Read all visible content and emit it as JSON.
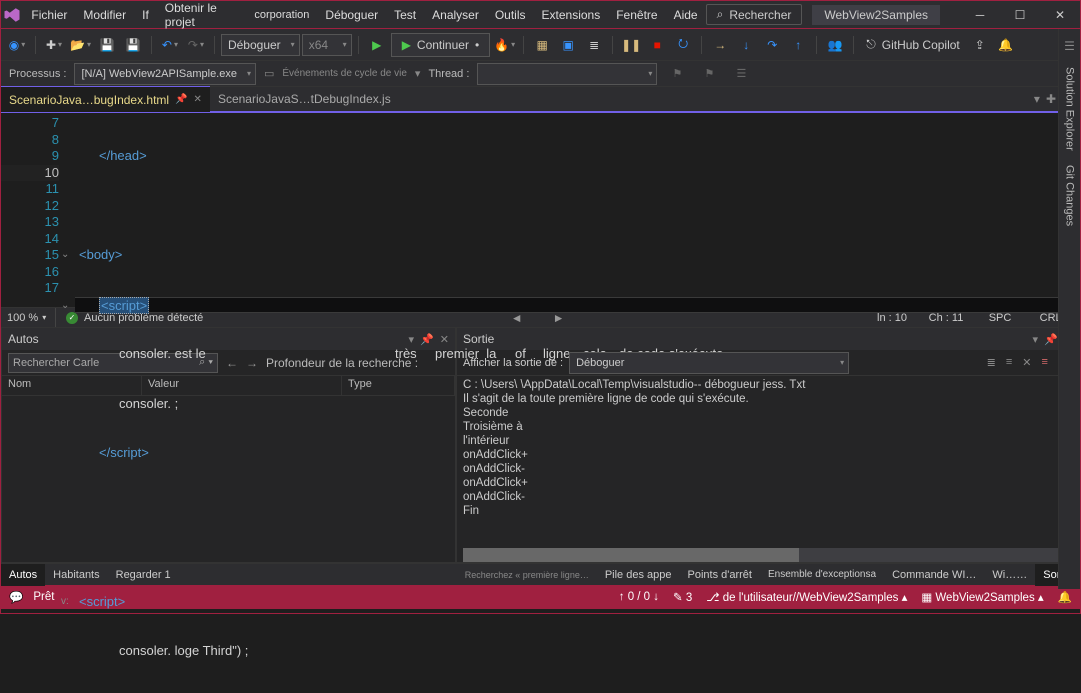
{
  "menu": {
    "file": "Fichier",
    "edit": "Modifier",
    "if": "If",
    "get": "Obtenir le projet",
    "corp": "corporation",
    "debug": "Déboguer",
    "test": "Test",
    "analyze": "Analyser",
    "tools": "Outils",
    "ext": "Extensions",
    "window": "Fenêtre",
    "help": "Aide"
  },
  "title_search": "Rechercher",
  "solution_name": "WebView2Samples",
  "toolbar": {
    "config": "Déboguer",
    "platform": "x64",
    "continue": "Continuer",
    "copilot": "GitHub Copilot"
  },
  "procbar": {
    "process_label": "Processus :",
    "process_value": "[N/A] WebView2APISample.exe",
    "lifecycle": "Événements de cycle de vie",
    "thread_label": "Thread :"
  },
  "tabs": {
    "active": "ScenarioJava…bugIndex.html",
    "inactive": "ScenarioJavaS…tDebugIndex.js"
  },
  "code": {
    "lines": [
      {
        "n": 7,
        "html": "</head>",
        "cls": "tag"
      },
      {
        "n": 8,
        "html": ""
      },
      {
        "n": 9,
        "html": "<body>",
        "cls": "tag",
        "chev": "⌄"
      },
      {
        "n": 10,
        "html": "<script>",
        "cls": "tag",
        "chev": "⌄",
        "bp": true,
        "sel": true
      },
      {
        "n": 11,
        "html": "consoler. est le                           très        premier  la          of      ligne     cela      de code s'exécute.",
        "cls": "txt"
      },
      {
        "n": 12,
        "html": "consoler. ;",
        "cls": "txt"
      },
      {
        "n": 13,
        "html": "</script>",
        "cls": "tag"
      },
      {
        "n": 14,
        "html": ""
      },
      {
        "n": 15,
        "html": ""
      },
      {
        "n": 16,
        "html": "<script>",
        "cls": "tag",
        "chev": "v:"
      },
      {
        "n": 17,
        "html": "consoler. loge Third\") ;",
        "cls": "txt"
      }
    ]
  },
  "codebar": {
    "zoom": "100 %",
    "noissues": "Aucun problème détecté",
    "ln": "ln : 10",
    "ch": "Ch : 11",
    "spc": "SPC",
    "crlf": "CRLF"
  },
  "autos": {
    "title": "Autos",
    "search_placeholder": "Rechercher Carle",
    "depth_label": "Profondeur de la recherche :",
    "cols": {
      "name": "Nom",
      "value": "Valeur",
      "type": "Type"
    }
  },
  "sortie": {
    "title": "Sortie",
    "show_label": "Afficher la sortie de :",
    "show_value": "Déboguer",
    "lines": [
      "C : \\Users\\                                \\AppData\\Local\\Temp\\visualstudio-- débogueur jess. Txt",
      "Il s'agit de la toute première ligne de code qui s'exécute.",
      "Seconde",
      "Troisième à",
      "l'intérieur",
      "onAddClick+",
      "onAddClick-",
      "onAddClick+",
      "onAddClick-",
      "Fin"
    ]
  },
  "bottom_tabs": {
    "left": [
      "Autos",
      "Habitants",
      "Regarder 1"
    ],
    "right": [
      "Recherchez « première ligne…",
      "Pile des appe",
      "Points d'arrêt",
      "Ensemble d'exceptionsa",
      "Commande WI…",
      "Wi……",
      "Sortie"
    ]
  },
  "status": {
    "ready": "Prêt",
    "updown": "↑ 0 / 0 ↓",
    "edits": "3",
    "branch": "de l'utilisateur//WebView2Samples",
    "repo": "WebView2Samples"
  },
  "rails": {
    "sol": "Solution Explorer",
    "git": "Git Changes"
  }
}
